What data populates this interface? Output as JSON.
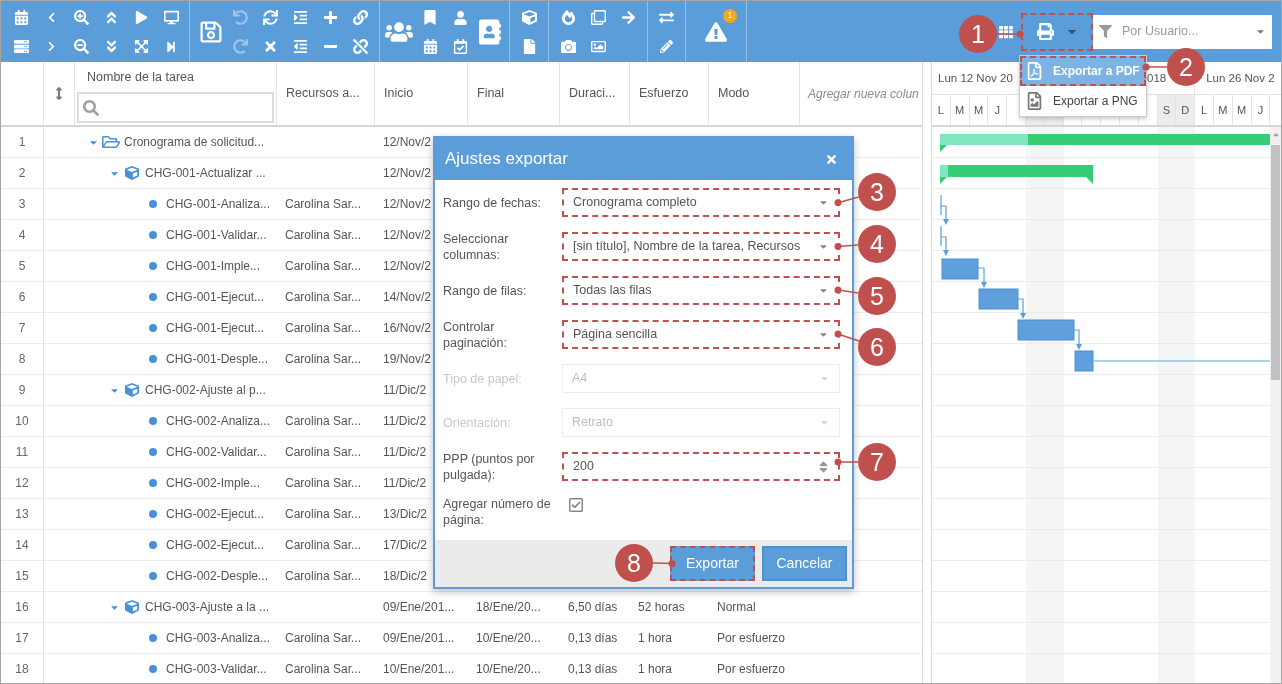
{
  "toolbar": {
    "undo": {
      "disabled": true
    },
    "redo": {
      "disabled": true
    },
    "alerts": {
      "count": "1"
    },
    "export": {
      "highlighted": true,
      "menu_open": true
    },
    "export_menu": [
      {
        "label": "Exportar a PDF",
        "kind": "pdf",
        "selected": true,
        "highlighted": true
      },
      {
        "label": "Exportar a PNG",
        "kind": "png",
        "selected": false,
        "highlighted": false
      }
    ],
    "filter": {
      "placeholder": "Por Usuario..."
    }
  },
  "table": {
    "columns": [
      "Nombre de la tarea",
      "Recursos a...",
      "Inicio",
      "Final",
      "Duraci...",
      "Esfuerzo",
      "Modo"
    ],
    "add_column": "Agregar nueva colun",
    "rows": [
      {
        "number": "1",
        "kind": "project",
        "expanded": true,
        "name": "Cronograma de solicitud...",
        "start": "12/Nov/2",
        "children": [
          {
            "number": "2",
            "kind": "group",
            "expanded": true,
            "name": "CHG-001-Actualizar ...",
            "start": "12/Nov/2",
            "children": [
              {
                "number": "3",
                "kind": "task",
                "name": "CHG-001-Analiza...",
                "resources": "Carolina Sar...",
                "start": "12/Nov/2"
              },
              {
                "number": "4",
                "kind": "task",
                "name": "CHG-001-Validar...",
                "resources": "Carolina Sar...",
                "start": "12/Nov/2"
              },
              {
                "number": "5",
                "kind": "task",
                "name": "CHG-001-Imple...",
                "resources": "Carolina Sar...",
                "start": "12/Nov/2"
              },
              {
                "number": "6",
                "kind": "task",
                "name": "CHG-001-Ejecut...",
                "resources": "Carolina Sar...",
                "start": "14/Nov/2"
              },
              {
                "number": "7",
                "kind": "task",
                "name": "CHG-001-Ejecut...",
                "resources": "Carolina Sar...",
                "start": "16/Nov/2"
              },
              {
                "number": "8",
                "kind": "task",
                "name": "CHG-001-Desple...",
                "resources": "Carolina Sar...",
                "start": "19/Nov/2"
              }
            ]
          },
          {
            "number": "9",
            "kind": "group",
            "expanded": true,
            "name": "CHG-002-Ajuste al p...",
            "start": "11/Dic/2",
            "children": [
              {
                "number": "10",
                "kind": "task",
                "name": "CHG-002-Analiza...",
                "resources": "Carolina Sar...",
                "start": "11/Dic/2"
              },
              {
                "number": "11",
                "kind": "task",
                "name": "CHG-002-Validar...",
                "resources": "Carolina Sar...",
                "start": "11/Dic/2"
              },
              {
                "number": "12",
                "kind": "task",
                "name": "CHG-002-Imple...",
                "resources": "Carolina Sar...",
                "start": "11/Dic/2"
              },
              {
                "number": "13",
                "kind": "task",
                "name": "CHG-002-Ejecut...",
                "resources": "Carolina Sar...",
                "start": "13/Dic/2"
              },
              {
                "number": "14",
                "kind": "task",
                "name": "CHG-002-Ejecut...",
                "resources": "Carolina Sar...",
                "start": "17/Dic/2"
              },
              {
                "number": "15",
                "kind": "task",
                "name": "CHG-002-Desple...",
                "resources": "Carolina Sar...",
                "start": "18/Dic/2"
              }
            ]
          },
          {
            "number": "16",
            "kind": "group",
            "expanded": true,
            "name": "CHG-003-Ajuste a la ...",
            "start": "09/Ene/201...",
            "end": "18/Ene/20...",
            "duration": "6,50 días",
            "effort": "52 horas",
            "mode": "Normal",
            "children": [
              {
                "number": "17",
                "kind": "task",
                "name": "CHG-003-Analiza...",
                "resources": "Carolina Sar...",
                "start": "09/Ene/201...",
                "end": "10/Ene/20...",
                "duration": "0,13 días",
                "effort": "1 hora",
                "mode": "Por esfuerzo"
              },
              {
                "number": "18",
                "kind": "task",
                "name": "CHG-003-Validar...",
                "resources": "Carolina Sar...",
                "start": "10/Ene/201...",
                "end": "10/Ene/20...",
                "duration": "0,13 días",
                "effort": "1 hora",
                "mode": "Por esfuerzo"
              }
            ]
          }
        ]
      }
    ]
  },
  "gantt": {
    "weeks": [
      "Lun 12 Nov 20",
      "018",
      "Lun 26 Nov 2"
    ],
    "days": [
      {
        "label": "L",
        "weekend": false
      },
      {
        "label": "M",
        "weekend": false
      },
      {
        "label": "M",
        "weekend": false
      },
      {
        "label": "J",
        "weekend": false
      },
      {
        "weekend": false
      },
      {
        "weekend": true
      },
      {
        "weekend": true
      },
      {
        "weekend": false
      },
      {
        "weekend": false
      },
      {
        "weekend": false
      },
      {
        "weekend": false
      },
      {
        "weekend": false
      },
      {
        "label": "S",
        "weekend": true
      },
      {
        "label": "D",
        "weekend": true
      },
      {
        "label": "L",
        "weekend": false
      },
      {
        "label": "M",
        "weekend": false
      },
      {
        "label": "M",
        "weekend": false
      },
      {
        "label": "J",
        "weekend": false
      }
    ]
  },
  "dialog": {
    "title": "Ajustes exportar",
    "fields": [
      {
        "label": "Rango de fechas:",
        "kind": "select",
        "value": "Cronograma completo",
        "disabled": false,
        "highlighted": true
      },
      {
        "label": "Seleccionar columnas:",
        "kind": "select",
        "value": "[sin título], Nombre de la tarea, Recursos",
        "disabled": false,
        "highlighted": true
      },
      {
        "label": "Rango de filas:",
        "kind": "select",
        "value": "Todas las filas",
        "disabled": false,
        "highlighted": true
      },
      {
        "label": "Controlar paginación:",
        "kind": "select",
        "value": "Página sencilla",
        "disabled": false,
        "highlighted": true
      },
      {
        "label": "Tipo de papel:",
        "kind": "select",
        "value": "A4",
        "disabled": true,
        "highlighted": false
      },
      {
        "label": "Orientación:",
        "kind": "select",
        "value": "Retrato",
        "disabled": true,
        "highlighted": false
      },
      {
        "label": "PPP (puntos por pulgada):",
        "kind": "number",
        "value": "200",
        "disabled": false,
        "highlighted": true
      },
      {
        "label": "Agregar número de página:",
        "kind": "checkbox",
        "checked": true
      }
    ],
    "buttons": [
      {
        "label": "Exportar",
        "highlighted": true
      },
      {
        "label": "Cancelar",
        "highlighted": false
      }
    ]
  },
  "callouts": [
    "1",
    "2",
    "3",
    "4",
    "5",
    "6",
    "7",
    "8"
  ]
}
